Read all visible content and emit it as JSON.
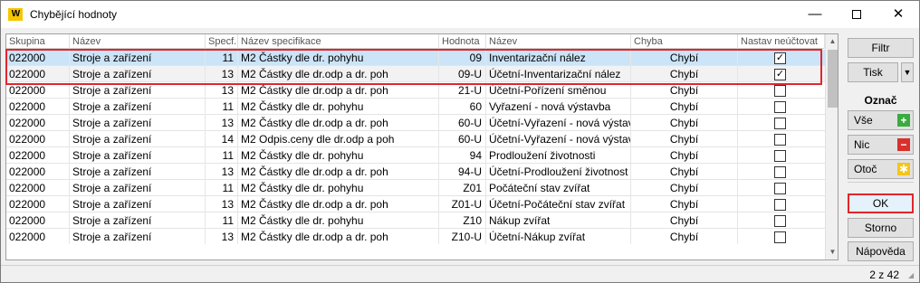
{
  "window": {
    "title": "Chybějící hodnoty",
    "app_icon_text": "W",
    "minimize_glyph": "—",
    "close_glyph": "✕"
  },
  "grid": {
    "columns": [
      "Skupina",
      "Název",
      "Specf.",
      "Název specifikace",
      "Hodnota",
      "Název",
      "Chyba",
      "Nastav neúčtovat"
    ],
    "rows": [
      {
        "skupina": "022000",
        "nazev": "Stroje a zařízení",
        "specf": "11",
        "nazev_spec": "M2 Částky dle dr. pohyhu",
        "hodnota": "09",
        "nazev2": "Inventarizační nález",
        "chyba": "Chybí",
        "checked": true
      },
      {
        "skupina": "022000",
        "nazev": "Stroje a zařízení",
        "specf": "13",
        "nazev_spec": "M2 Částky dle dr.odp a dr. poh",
        "hodnota": "09-U",
        "nazev2": "Účetní-Inventarizační nález",
        "chyba": "Chybí",
        "checked": true
      },
      {
        "skupina": "022000",
        "nazev": "Stroje a zařízení",
        "specf": "13",
        "nazev_spec": "M2 Částky dle dr.odp a dr. poh",
        "hodnota": "21-U",
        "nazev2": "Účetní-Pořízení směnou",
        "chyba": "Chybí",
        "checked": false
      },
      {
        "skupina": "022000",
        "nazev": "Stroje a zařízení",
        "specf": "11",
        "nazev_spec": "M2 Částky dle dr. pohyhu",
        "hodnota": "60",
        "nazev2": "Vyřazení - nová výstavba",
        "chyba": "Chybí",
        "checked": false
      },
      {
        "skupina": "022000",
        "nazev": "Stroje a zařízení",
        "specf": "13",
        "nazev_spec": "M2 Částky dle dr.odp a dr. poh",
        "hodnota": "60-U",
        "nazev2": "Účetní-Vyřazení - nová výstav",
        "chyba": "Chybí",
        "checked": false
      },
      {
        "skupina": "022000",
        "nazev": "Stroje a zařízení",
        "specf": "14",
        "nazev_spec": "M2 Odpis.ceny dle dr.odp a poh",
        "hodnota": "60-U",
        "nazev2": "Účetní-Vyřazení - nová výstav",
        "chyba": "Chybí",
        "checked": false
      },
      {
        "skupina": "022000",
        "nazev": "Stroje a zařízení",
        "specf": "11",
        "nazev_spec": "M2 Částky dle dr. pohyhu",
        "hodnota": "94",
        "nazev2": "Prodloužení životnosti",
        "chyba": "Chybí",
        "checked": false
      },
      {
        "skupina": "022000",
        "nazev": "Stroje a zařízení",
        "specf": "13",
        "nazev_spec": "M2 Částky dle dr.odp a dr. poh",
        "hodnota": "94-U",
        "nazev2": "Účetní-Prodloužení životnost",
        "chyba": "Chybí",
        "checked": false
      },
      {
        "skupina": "022000",
        "nazev": "Stroje a zařízení",
        "specf": "11",
        "nazev_spec": "M2 Částky dle dr. pohyhu",
        "hodnota": "Z01",
        "nazev2": "Počáteční stav zvířat",
        "chyba": "Chybí",
        "checked": false
      },
      {
        "skupina": "022000",
        "nazev": "Stroje a zařízení",
        "specf": "13",
        "nazev_spec": "M2 Částky dle dr.odp a dr. poh",
        "hodnota": "Z01-U",
        "nazev2": "Účetní-Počáteční stav zvířat",
        "chyba": "Chybí",
        "checked": false
      },
      {
        "skupina": "022000",
        "nazev": "Stroje a zařízení",
        "specf": "11",
        "nazev_spec": "M2 Částky dle dr. pohyhu",
        "hodnota": "Z10",
        "nazev2": "Nákup zvířat",
        "chyba": "Chybí",
        "checked": false
      },
      {
        "skupina": "022000",
        "nazev": "Stroje a zařízení",
        "specf": "13",
        "nazev_spec": "M2 Částky dle dr.odp a dr. poh",
        "hodnota": "Z10-U",
        "nazev2": "Účetní-Nákup zvířat",
        "chyba": "Chybí",
        "checked": false
      }
    ]
  },
  "side": {
    "filtr": "Filtr",
    "tisk": "Tisk",
    "tisk_arrow": "▼",
    "oznac": "Označ",
    "vse": "Vše",
    "vse_glyph": "+",
    "nic": "Nic",
    "nic_glyph": "−",
    "otoc": "Otoč",
    "otoc_glyph": "✱",
    "ok": "OK",
    "storno": "Storno",
    "napoveda": "Nápověda"
  },
  "status": {
    "count": "2 z 42"
  },
  "colors": {
    "selected_row": "#cce4f7",
    "highlight": "#e0262c",
    "app_icon": "#f7c600"
  }
}
